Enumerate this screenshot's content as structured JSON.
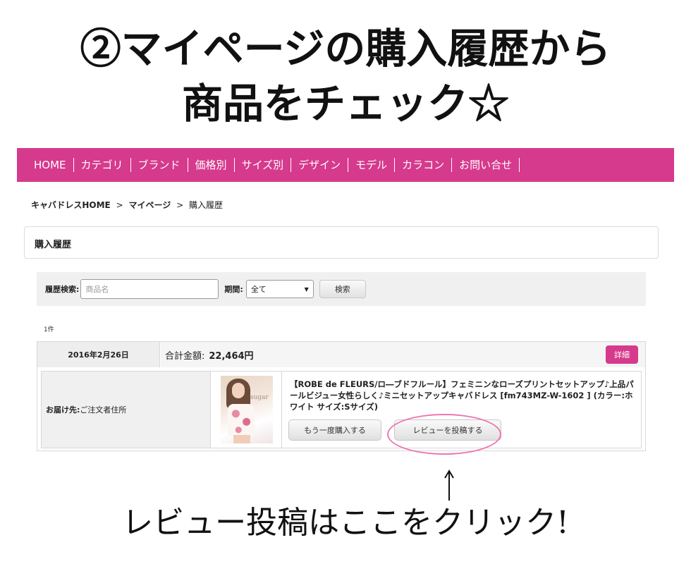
{
  "headline": {
    "line1": "②マイページの購入履歴から",
    "line2": "商品をチェック☆"
  },
  "nav": {
    "items": [
      "HOME",
      "カテゴリ",
      "ブランド",
      "価格別",
      "サイズ別",
      "デザイン",
      "モデル",
      "カラコン",
      "お問い合せ"
    ]
  },
  "breadcrumb": {
    "home": "キャバドレスHOME",
    "sep": ">",
    "mypage": "マイページ",
    "current": "購入履歴"
  },
  "section_title": "購入履歴",
  "search": {
    "label": "履歴検索:",
    "placeholder": "商品名",
    "period_label": "期間:",
    "period_value": "全て",
    "button": "検索"
  },
  "result_count": "1件",
  "order": {
    "date": "2016年2月26日",
    "total_label": "合計金額:",
    "total_value": "22,464円",
    "detail_button": "詳細",
    "ship_label": "お届け先:",
    "ship_value": "ご注文者住所",
    "thumb_brand": "sugar",
    "description": "【ROBE de FLEURS/ロ―ブドフルール】フェミニンなローズプリントセットアップ♪上品パールビジュー女性らしく♪ミニセットアップキャバドレス [fm743MZ-W-1602 ] (カラー:ホワイト サイズ:Sサイズ)",
    "rebuy_button": "もう一度購入する",
    "review_button": "レビューを投稿する"
  },
  "caption": "レビュー投稿はここをクリック!",
  "colors": {
    "accent": "#d63a8c",
    "highlight": "#ef76b4"
  }
}
